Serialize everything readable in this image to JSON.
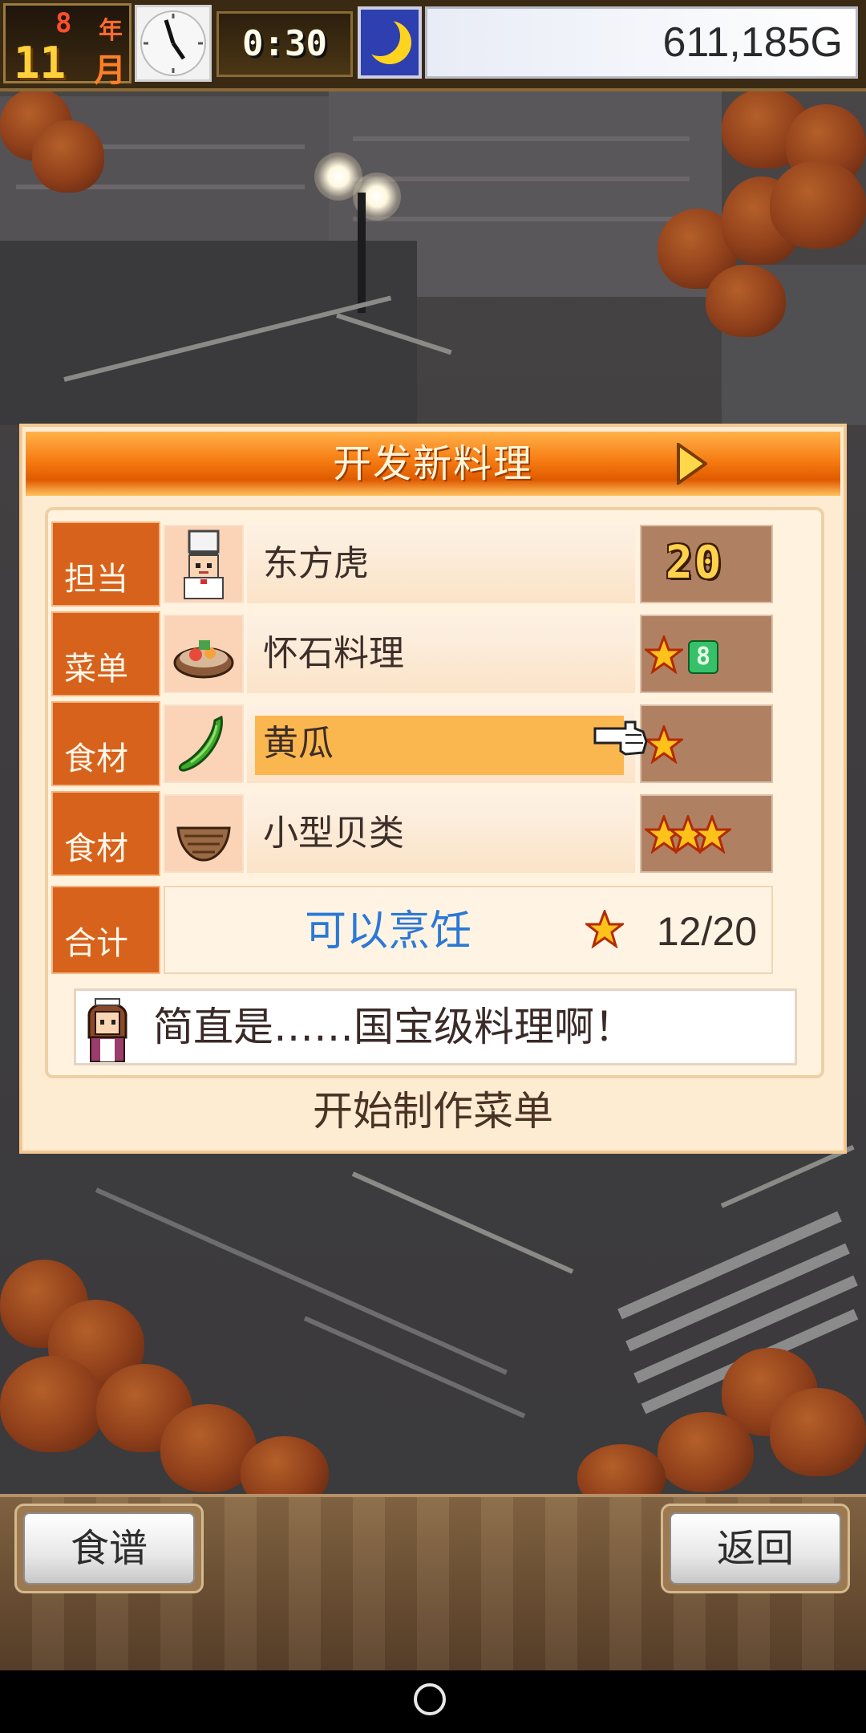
{
  "hud": {
    "year": "8",
    "year_unit": "年",
    "month": "11",
    "month_unit": "月",
    "time": "0:30",
    "money": "611,185G",
    "clock_icon": "clock-icon",
    "moon_icon": "moon-icon"
  },
  "dialog": {
    "title": "开发新料理",
    "rows": [
      {
        "label": "担当",
        "icon": "chef-icon",
        "value": "东方虎",
        "rank_text": "20",
        "stars": 0
      },
      {
        "label": "菜单",
        "icon": "kaiseki-dish-icon",
        "value": "怀石料理",
        "stars": 1,
        "level": "8"
      },
      {
        "label": "食材",
        "icon": "cucumber-icon",
        "value": "黄瓜",
        "stars": 1,
        "selected": true
      },
      {
        "label": "食材",
        "icon": "shellfish-icon",
        "value": "小型贝类",
        "stars": 3
      }
    ],
    "total": {
      "label": "合计",
      "status": "可以烹饪",
      "score": "12/20"
    },
    "comment": "简直是……国宝级料理啊！",
    "start_label": "开始制作菜单"
  },
  "bottom": {
    "recipe_label": "食谱",
    "back_label": "返回"
  },
  "colors": {
    "header_orange": "#f67c12",
    "label_orange": "#d7621c",
    "status_blue": "#2b78d6",
    "selected_row": "#fbb74f"
  }
}
